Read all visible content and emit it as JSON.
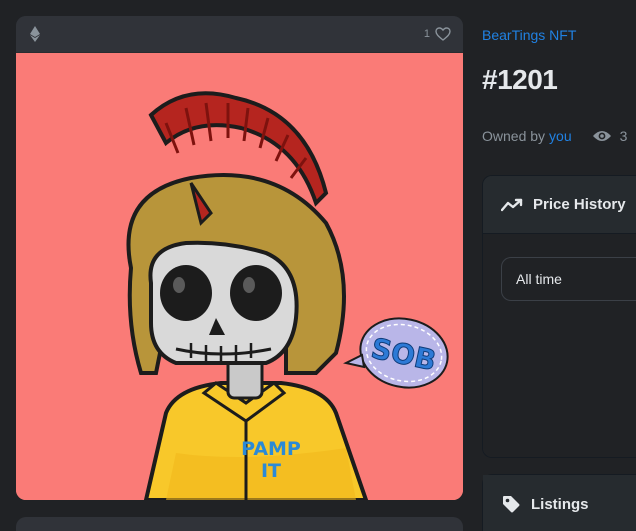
{
  "card": {
    "chain_icon": "ethereum-icon",
    "favorite_count": "1",
    "favorite_icon": "heart-outline-icon",
    "image": {
      "background_color": "#fa7b77",
      "badge_text": "SOB",
      "shirt_text_line1": "PAMP",
      "shirt_text_line2": "IT"
    }
  },
  "collection": {
    "name": "BearTings NFT"
  },
  "token": {
    "title": "#1201"
  },
  "owner": {
    "prefix": "Owned by",
    "name": "you",
    "views": "3",
    "views_icon": "eye-icon"
  },
  "price_history": {
    "title": "Price History",
    "icon": "trend-line-icon",
    "range_value": "All time"
  },
  "listings": {
    "title": "Listings",
    "icon": "tag-icon"
  },
  "colors": {
    "accent": "#2081e2",
    "background": "#202225",
    "card": "#303339"
  }
}
